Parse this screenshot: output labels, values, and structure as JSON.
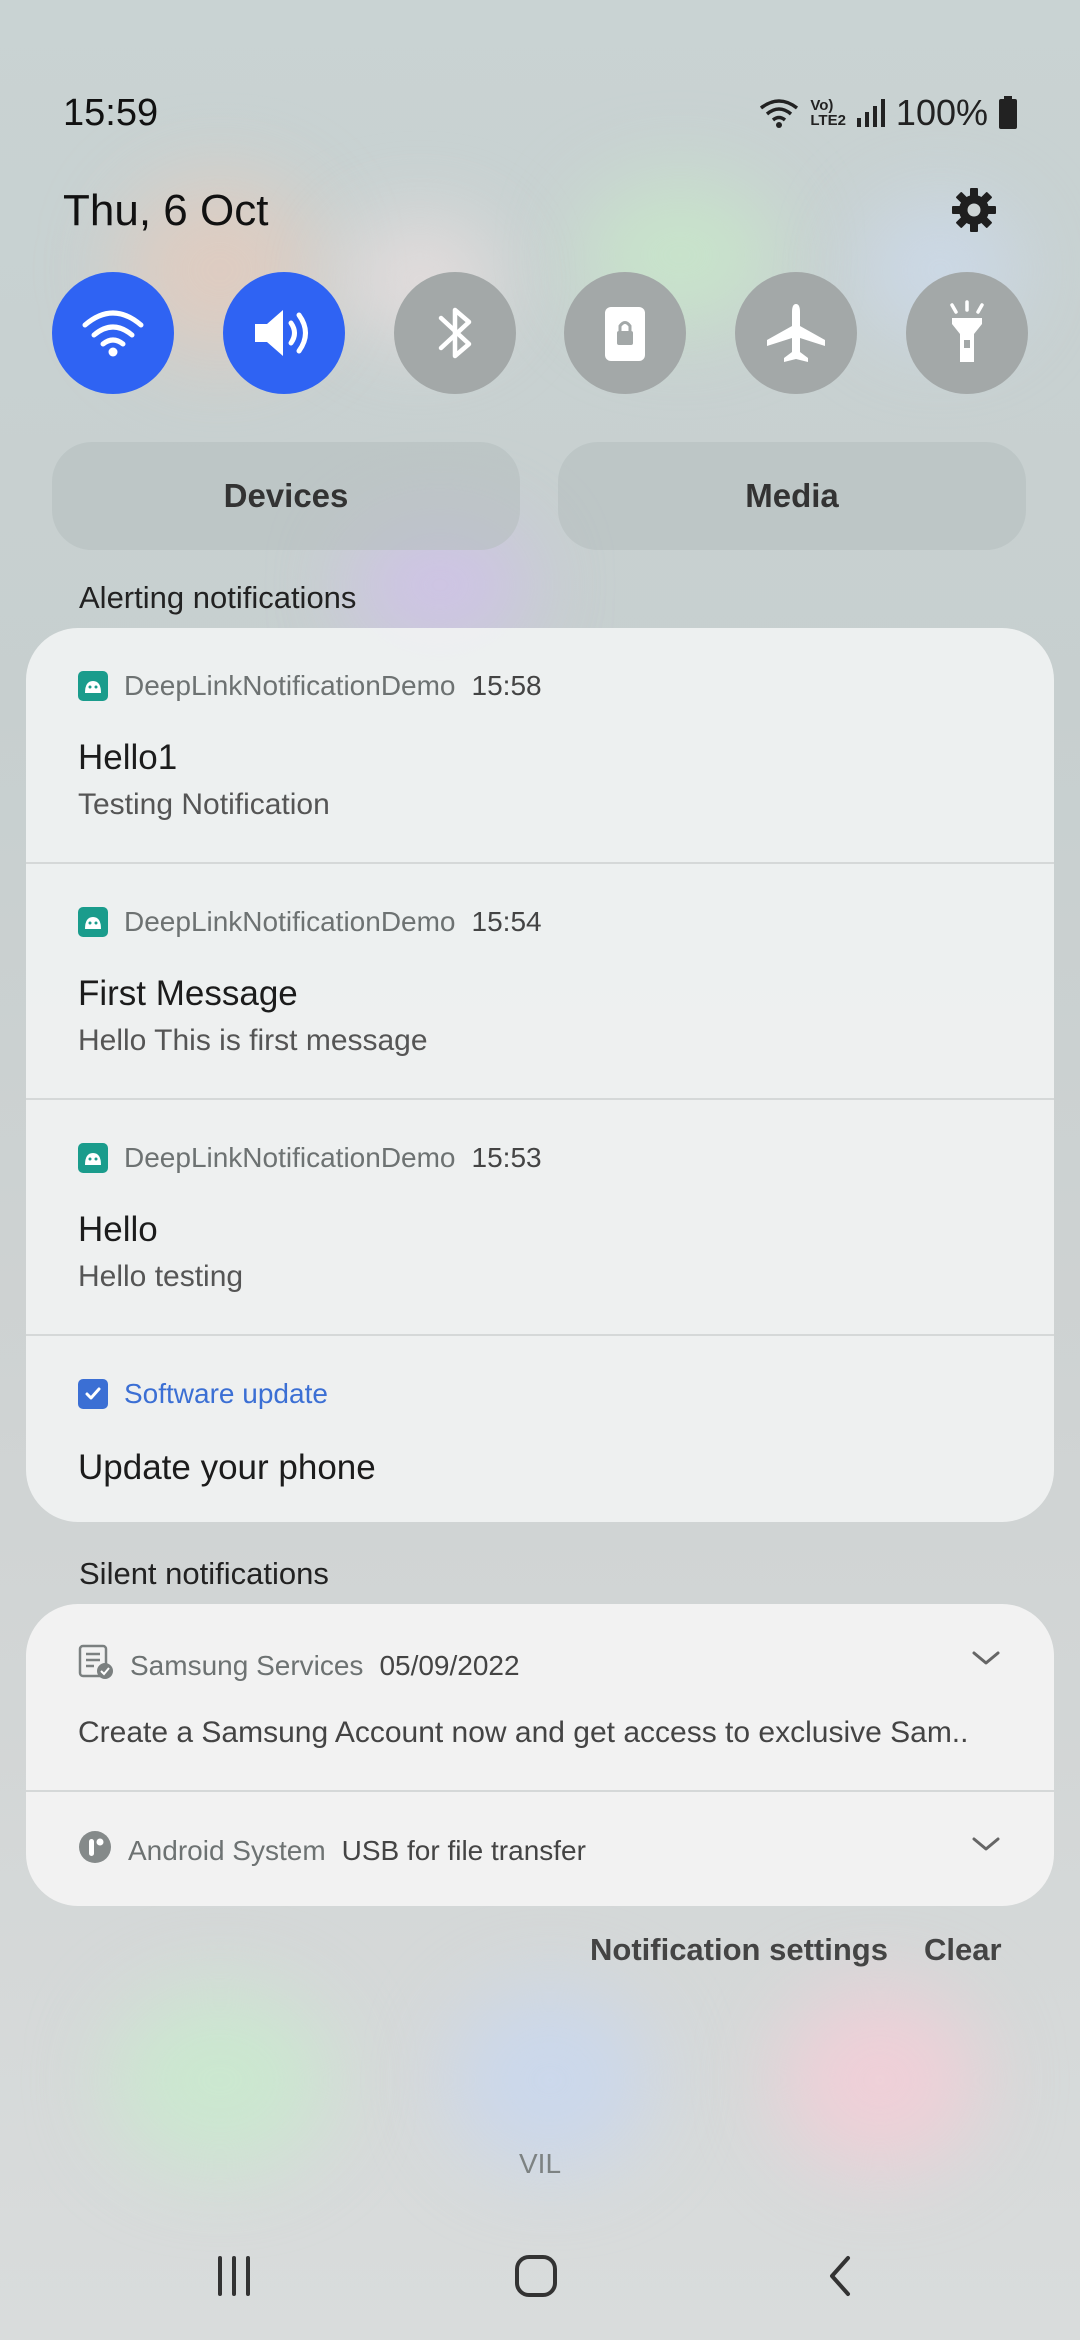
{
  "status_bar": {
    "time": "15:59",
    "battery": "100%",
    "network": "LTE2"
  },
  "header": {
    "date": "Thu, 6 Oct"
  },
  "quick_settings": [
    {
      "name": "wifi",
      "active": true
    },
    {
      "name": "sound",
      "active": true
    },
    {
      "name": "bluetooth",
      "active": false
    },
    {
      "name": "portrait-lock",
      "active": false
    },
    {
      "name": "airplane",
      "active": false
    },
    {
      "name": "flashlight",
      "active": false
    }
  ],
  "pills": {
    "devices": "Devices",
    "media": "Media"
  },
  "alerting": {
    "label": "Alerting notifications",
    "items": [
      {
        "app": "DeepLinkNotificationDemo",
        "time": "15:58",
        "title": "Hello1",
        "text": "Testing Notification"
      },
      {
        "app": "DeepLinkNotificationDemo",
        "time": "15:54",
        "title": "First Message",
        "text": "Hello This is first message"
      },
      {
        "app": "DeepLinkNotificationDemo",
        "time": "15:53",
        "title": "Hello",
        "text": "Hello testing"
      }
    ],
    "software_update": {
      "app": "Software update",
      "title": "Update your phone"
    }
  },
  "silent": {
    "label": "Silent notifications",
    "items": [
      {
        "app": "Samsung Services",
        "time": "05/09/2022",
        "text": "Create a Samsung Account now and get access to exclusive Sam.."
      },
      {
        "app": "Android System",
        "text": "USB for file transfer"
      }
    ]
  },
  "footer": {
    "settings_label": "Notification settings",
    "clear_label": "Clear"
  },
  "carrier": "VIL",
  "colors": {
    "accent": "#2f63f3",
    "app_icon": "#1a9c8c",
    "update_link": "#3b6fd4"
  }
}
